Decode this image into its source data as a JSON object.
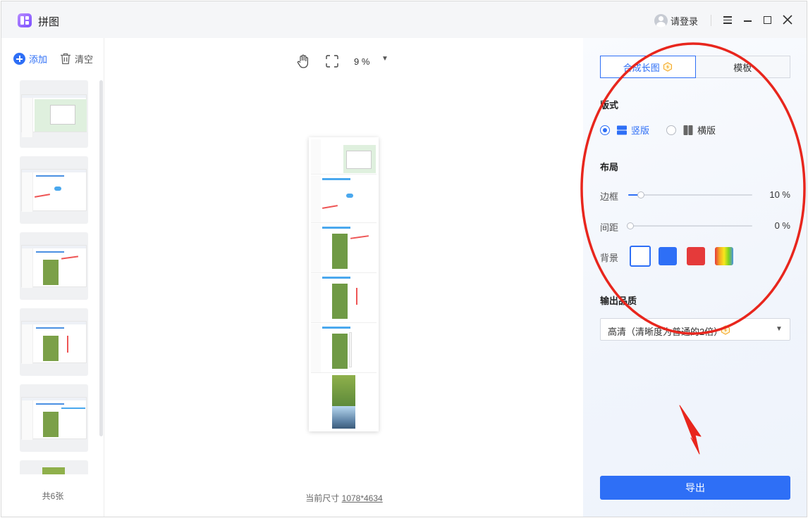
{
  "app": {
    "title": "拼图"
  },
  "titlebar": {
    "login_label": "请登录"
  },
  "sidebar": {
    "add_label": "添加",
    "clear_label": "清空",
    "count_label": "共6张"
  },
  "canvas": {
    "zoom_value": "9 %",
    "size_prefix": "当前尺寸",
    "size_value": "1078*4634"
  },
  "panel": {
    "tabs": [
      {
        "label": "合成长图",
        "active": true
      },
      {
        "label": "模板",
        "active": false
      }
    ],
    "format": {
      "title": "版式",
      "options": [
        {
          "label": "竖版",
          "selected": true
        },
        {
          "label": "横版",
          "selected": false
        }
      ]
    },
    "layout": {
      "title": "布局",
      "border": {
        "label": "边框",
        "value": 10,
        "display": "10 %"
      },
      "spacing": {
        "label": "间距",
        "value": 0,
        "display": "0 %"
      },
      "background": {
        "label": "背景",
        "swatches": [
          "#ffffff",
          "#2e6ff6",
          "#e53a3a",
          "rainbow"
        ],
        "selected": "#ffffff"
      }
    },
    "quality": {
      "title": "输出品质",
      "selected": "高清（清晰度为普通的2倍）"
    },
    "export_label": "导出"
  },
  "colors": {
    "accent": "#2e6ff6",
    "annotation": "#e8261d"
  },
  "icons": [
    "app-logo-icon",
    "avatar-icon",
    "menu-icon",
    "minimize-icon",
    "maximize-icon",
    "close-icon",
    "add-icon",
    "trash-icon",
    "hand-icon",
    "fit-screen-icon",
    "vip-icon",
    "vertical-layout-icon",
    "horizontal-layout-icon"
  ]
}
